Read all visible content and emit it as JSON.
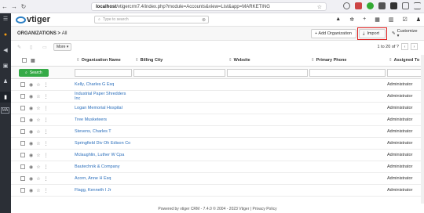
{
  "browser": {
    "url_host": "localhost",
    "url_rest": "/vtigercrm7.4/index.php?module=Accounts&view=List&app=MARKETING"
  },
  "app": {
    "logo_text": "vtiger",
    "search_placeholder": "Type to search"
  },
  "leftbar": {
    "ma_label": "MA"
  },
  "module": {
    "breadcrumb_module": "ORGANIZATIONS",
    "breadcrumb_sep": " > ",
    "breadcrumb_view": "All",
    "add_label": "+ Add Organization",
    "import_label": "Import",
    "customize_label": "Customize ▾"
  },
  "toolbar": {
    "more_label": "More ▾",
    "pager_text": "1 to 20  of ?"
  },
  "table": {
    "columns": [
      "Organization Name",
      "Billing City",
      "Website",
      "Primary Phone",
      "Assigned To"
    ],
    "search_label": "Search",
    "rows": [
      {
        "name": "Kelly, Charles G Esq",
        "assigned": "Administrator"
      },
      {
        "name": "Industrial Paper Shredders Inc",
        "assigned": "Administrator"
      },
      {
        "name": "Logan Memorial Hospital",
        "assigned": "Administrator"
      },
      {
        "name": "Tree Musketeers",
        "assigned": "Administrator"
      },
      {
        "name": "Stevens, Charles T",
        "assigned": "Administrator"
      },
      {
        "name": "Springfield Div Oh Edison Co",
        "assigned": "Administrator"
      },
      {
        "name": "Mclaughlin, Luther W Cpa",
        "assigned": "Administrator"
      },
      {
        "name": "Bautechnik & Company",
        "assigned": "Administrator"
      },
      {
        "name": "Acorn, Anne H Esq",
        "assigned": "Administrator"
      },
      {
        "name": "Flagg, Kenneth I Jr",
        "assigned": "Administrator"
      }
    ]
  },
  "footer": {
    "text": "Powered by vtiger CRM - 7.4.0  © 2004 - 2023   Vtiger  |  Privacy Policy"
  },
  "colors": {
    "accent": "#2b7fc4",
    "search_green": "#35aa47",
    "highlight_red": "#e02020",
    "sidebar": "#2b2f36"
  }
}
